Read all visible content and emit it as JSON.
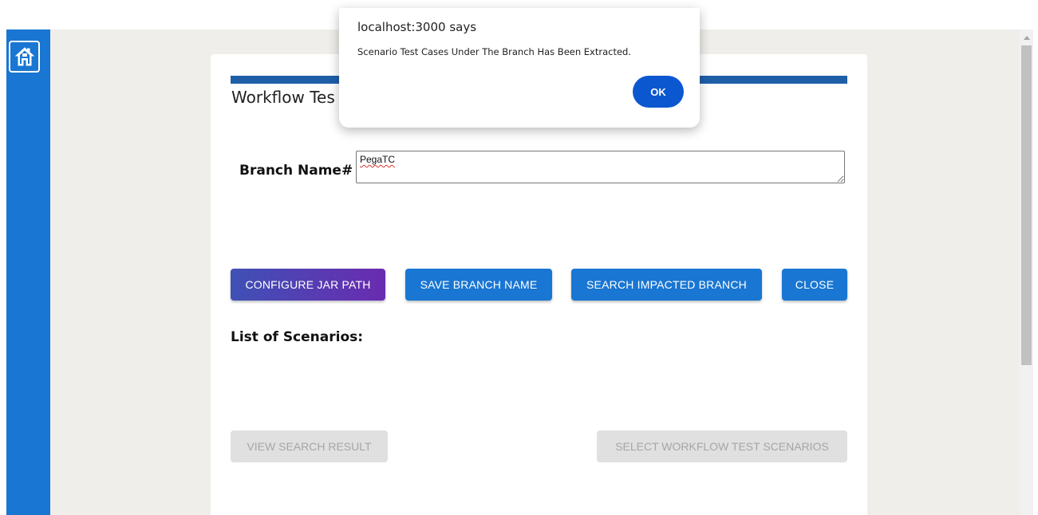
{
  "alert": {
    "origin": "localhost:3000 says",
    "message": "Scenario Test Cases Under The Branch Has Been Extracted.",
    "ok_label": "OK"
  },
  "card": {
    "title": "Workflow Tes",
    "branch_label": "Branch Name#",
    "branch_value": "PegaTC",
    "scenarios_heading": "List of Scenarios:"
  },
  "actions": {
    "configure_jar_path": "CONFIGURE JAR PATH",
    "save_branch_name": "SAVE BRANCH NAME",
    "search_impacted_branch": "SEARCH IMPACTED BRANCH",
    "close": "CLOSE"
  },
  "disabled_actions": {
    "view_search_result": "VIEW SEARCH RESULT",
    "select_workflow_test_scenarios": "SELECT WORKFLOW TEST SCENARIOS"
  },
  "icons": {
    "home": "home-icon",
    "scroll_up": "chevron-up-icon"
  },
  "colors": {
    "primary": "#1976d2",
    "gradient_start": "#3f51b5",
    "gradient_end": "#6a2bb0",
    "stripe": "#1f5fa8",
    "alert_ok": "#0b57d0",
    "page_bg": "#efeeea"
  }
}
